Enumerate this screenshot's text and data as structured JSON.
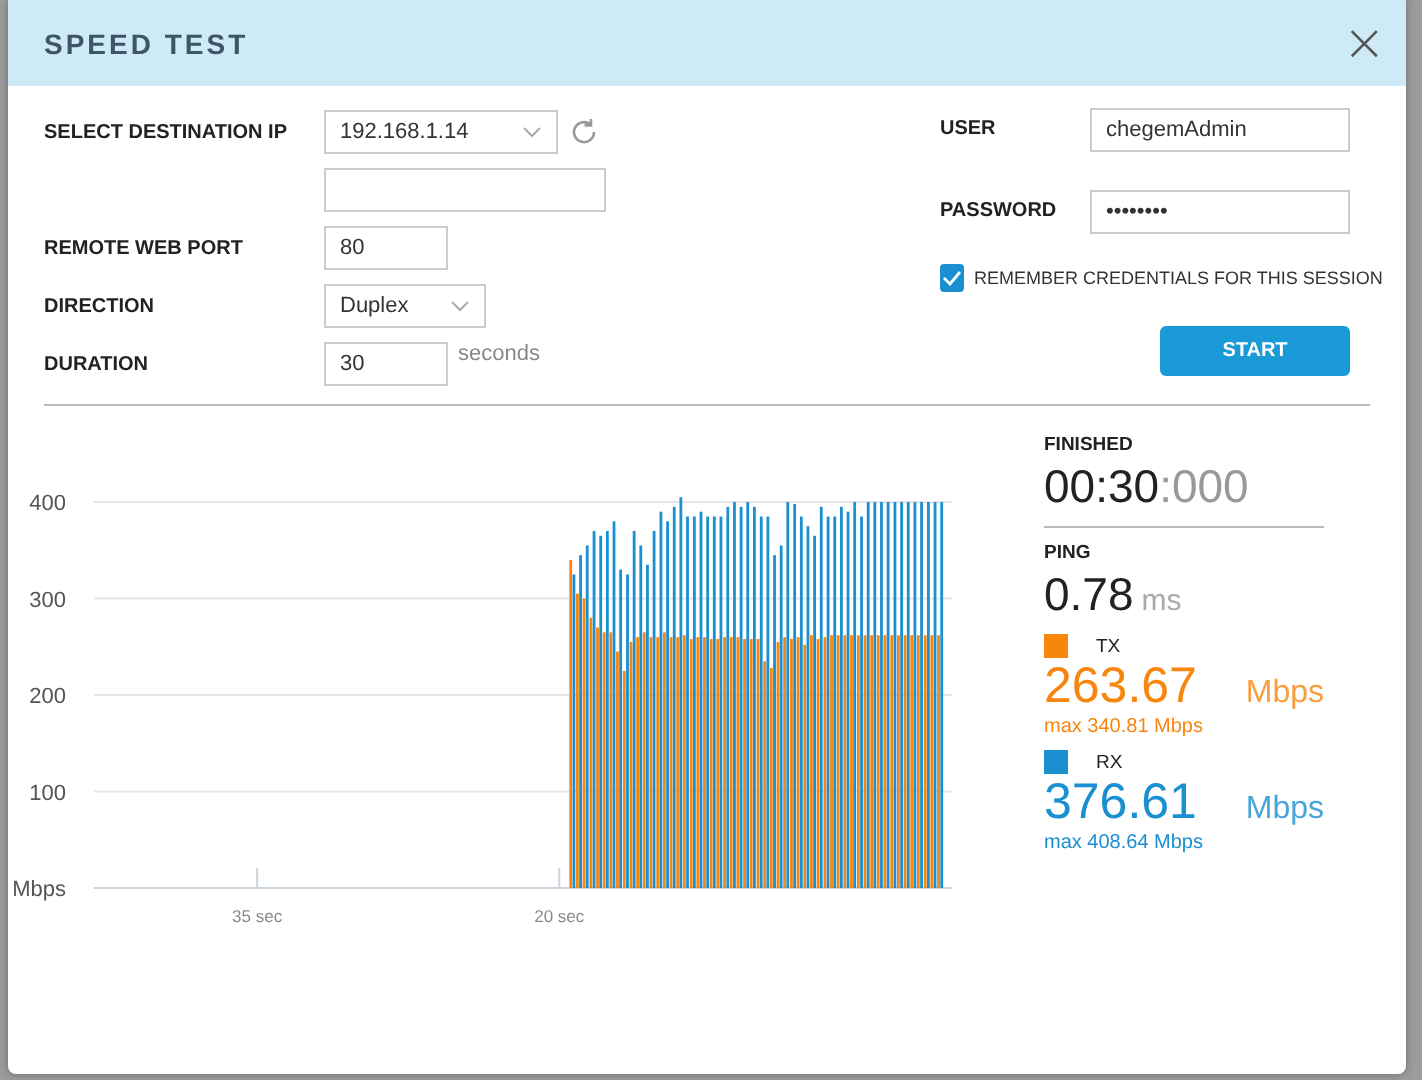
{
  "dialog": {
    "title": "SPEED TEST",
    "close": "×"
  },
  "form": {
    "fields": [
      {
        "kind": "select",
        "label": "SELECT DESTINATION IP",
        "value": "192.168.1.14",
        "refresh": true
      },
      {
        "kind": "blank"
      },
      {
        "kind": "text",
        "label": "REMOTE WEB PORT",
        "value": "80"
      },
      {
        "kind": "select",
        "label": "DIRECTION",
        "value": "Duplex",
        "refresh": false
      },
      {
        "kind": "text",
        "label": "DURATION",
        "value": "30",
        "suffix": "seconds"
      }
    ],
    "user": {
      "label": "USER",
      "value": "chegemAdmin"
    },
    "password": {
      "label": "PASSWORD",
      "value": "••••••••"
    },
    "remember": {
      "label": "REMEMBER CREDENTIALS FOR THIS SESSION",
      "checked": true
    },
    "start": "START"
  },
  "chart_data": {
    "type": "bar",
    "grid": true,
    "x": [
      19.5,
      19.17,
      18.84,
      18.5,
      18.17,
      17.84,
      17.51,
      17.18,
      16.84,
      16.51,
      16.18,
      15.85,
      15.52,
      15.18,
      14.85,
      14.52,
      14.19,
      13.86,
      13.52,
      13.19,
      12.86,
      12.53,
      12.2,
      11.86,
      11.53,
      11.2,
      10.87,
      10.54,
      10.2,
      9.87,
      9.54,
      9.21,
      8.88,
      8.54,
      8.21,
      7.88,
      7.55,
      7.22,
      6.88,
      6.55,
      6.22,
      5.89,
      5.56,
      5.22,
      4.89,
      4.56,
      4.23,
      3.9,
      3.56,
      3.23,
      2.9,
      2.57,
      2.24,
      1.9,
      1.57,
      1.24
    ],
    "xlim": [
      43.1,
      0.5
    ],
    "ylim": [
      0,
      410
    ],
    "xticks": [
      {
        "value": 35,
        "label": "35 sec"
      },
      {
        "value": 20,
        "label": "20 sec"
      }
    ],
    "yticks": [
      {
        "value": 0,
        "label": "Mbps"
      },
      100,
      200,
      300,
      400
    ],
    "series": [
      {
        "name": "TX",
        "color": "#f7860f",
        "values": [
          340,
          305,
          300,
          280,
          270,
          265,
          265,
          245,
          225,
          255,
          260,
          265,
          260,
          260,
          265,
          260,
          260,
          262,
          258,
          260,
          260,
          258,
          258,
          260,
          260,
          260,
          258,
          258,
          258,
          235,
          228,
          255,
          260,
          258,
          260,
          252,
          262,
          258,
          260,
          262,
          262,
          262,
          262,
          262,
          262,
          262,
          262,
          262,
          262,
          262,
          262,
          262,
          262,
          262,
          262,
          262
        ]
      },
      {
        "name": "RX",
        "color": "#1a8fd1",
        "values": [
          325,
          345,
          355,
          370,
          365,
          370,
          380,
          330,
          325,
          370,
          355,
          335,
          370,
          390,
          380,
          395,
          405,
          385,
          385,
          390,
          385,
          385,
          385,
          395,
          400,
          395,
          400,
          395,
          385,
          385,
          345,
          355,
          400,
          398,
          385,
          375,
          365,
          395,
          385,
          385,
          395,
          390,
          400,
          385,
          400,
          400,
          400,
          400,
          400,
          400,
          400,
          400,
          400,
          400,
          400,
          400
        ]
      }
    ]
  },
  "stats": {
    "status": "FINISHED",
    "time": "00:30",
    "time_ms": ":000",
    "ping_label": "PING",
    "ping": "0.78",
    "ping_unit": "ms",
    "rates": [
      {
        "value": "263.67",
        "unit": "Mbps",
        "max": "max 340.81 Mbps"
      },
      {
        "value": "376.61",
        "unit": "Mbps",
        "max": "max 408.64 Mbps"
      }
    ]
  }
}
